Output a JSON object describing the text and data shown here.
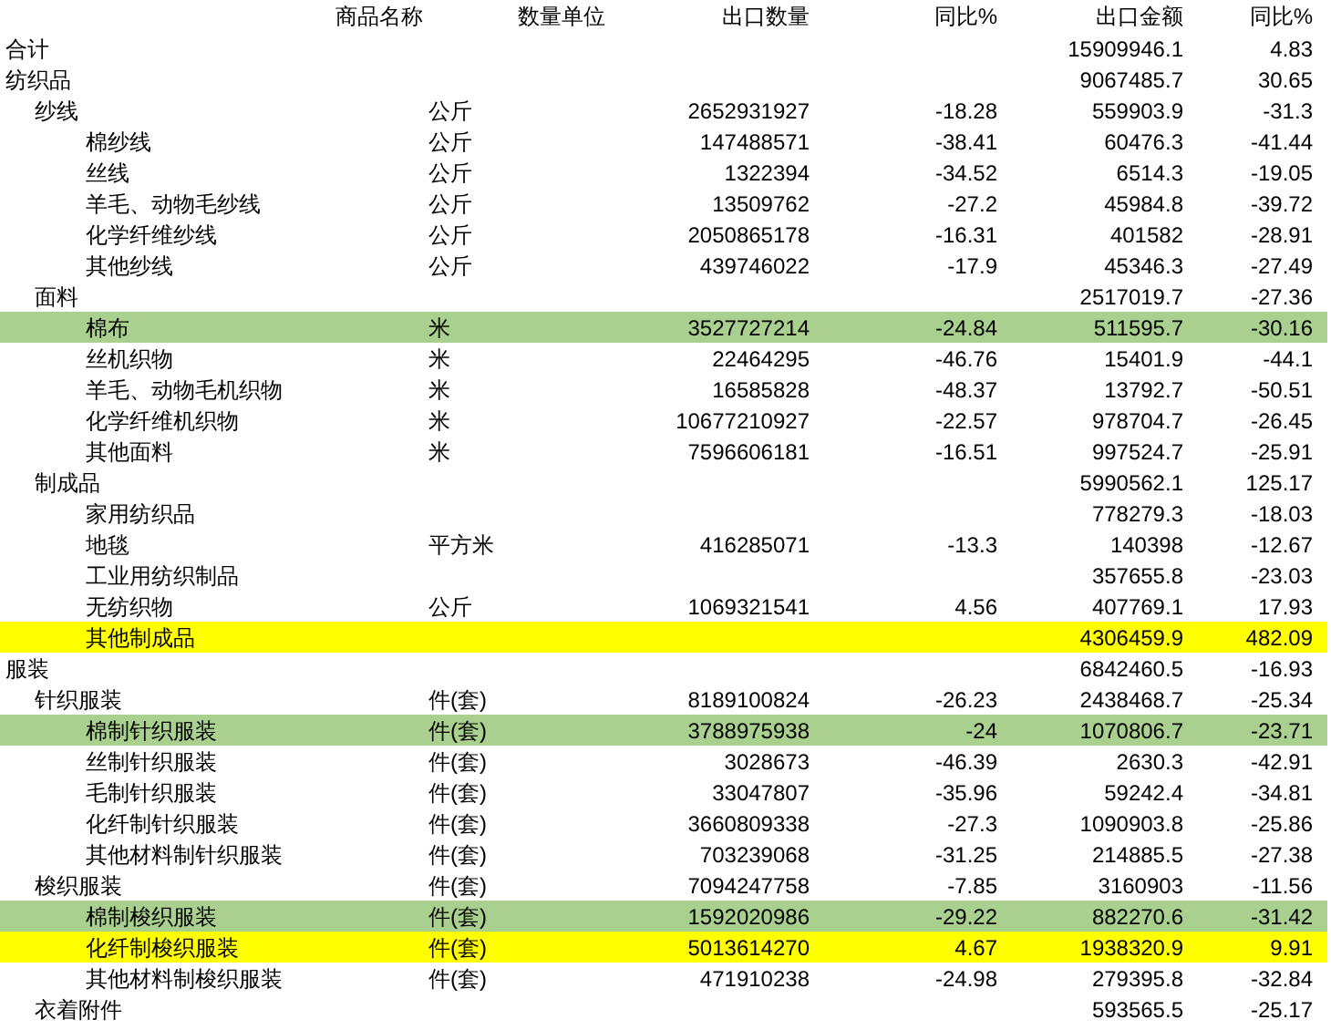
{
  "table": {
    "columns": [
      "商品名称",
      "数量单位",
      "出口数量",
      "同比%",
      "出口金额",
      "同比%"
    ],
    "rows": [
      {
        "name": "合计",
        "amount": "15909946.1",
        "amount_yoy": "4.83"
      },
      {
        "name": "纺织品",
        "amount": "9067485.7",
        "amount_yoy": "30.65",
        "children": [
          {
            "name": "纱线",
            "unit": "公斤",
            "quantity": "2652931927",
            "quantity_yoy": "-18.28",
            "amount": "559903.9",
            "amount_yoy": "-31.3",
            "children": [
              {
                "name": "棉纱线",
                "unit": "公斤",
                "quantity": "147488571",
                "quantity_yoy": "-38.41",
                "amount": "60476.3",
                "amount_yoy": "-41.44"
              },
              {
                "name": "丝线",
                "unit": "公斤",
                "quantity": "1322394",
                "quantity_yoy": "-34.52",
                "amount": "6514.3",
                "amount_yoy": "-19.05"
              },
              {
                "name": "羊毛、动物毛纱线",
                "unit": "公斤",
                "quantity": "13509762",
                "quantity_yoy": "-27.2",
                "amount": "45984.8",
                "amount_yoy": "-39.72"
              },
              {
                "name": "化学纤维纱线",
                "unit": "公斤",
                "quantity": "2050865178",
                "quantity_yoy": "-16.31",
                "amount": "401582",
                "amount_yoy": "-28.91"
              },
              {
                "name": "其他纱线",
                "unit": "公斤",
                "quantity": "439746022",
                "quantity_yoy": "-17.9",
                "amount": "45346.3",
                "amount_yoy": "-27.49"
              }
            ]
          },
          {
            "name": "面料",
            "amount": "2517019.7",
            "amount_yoy": "-27.36",
            "children": [
              {
                "name": "棉布",
                "unit": "米",
                "quantity": "3527727214",
                "quantity_yoy": "-24.84",
                "amount": "511595.7",
                "amount_yoy": "-30.16",
                "color": "#a9d08e"
              },
              {
                "name": "丝机织物",
                "unit": "米",
                "quantity": "22464295",
                "quantity_yoy": "-46.76",
                "amount": "15401.9",
                "amount_yoy": "-44.1"
              },
              {
                "name": "羊毛、动物毛机织物",
                "unit": "米",
                "quantity": "16585828",
                "quantity_yoy": "-48.37",
                "amount": "13792.7",
                "amount_yoy": "-50.51"
              },
              {
                "name": "化学纤维机织物",
                "unit": "米",
                "quantity": "10677210927",
                "quantity_yoy": "-22.57",
                "amount": "978704.7",
                "amount_yoy": "-26.45"
              },
              {
                "name": "其他面料",
                "unit": "米",
                "quantity": "7596606181",
                "quantity_yoy": "-16.51",
                "amount": "997524.7",
                "amount_yoy": "-25.91"
              }
            ]
          },
          {
            "name": "制成品",
            "amount": "5990562.1",
            "amount_yoy": "125.17",
            "children": [
              {
                "name": "家用纺织品",
                "amount": "778279.3",
                "amount_yoy": "-18.03"
              },
              {
                "name": "地毯",
                "unit": "平方米",
                "quantity": "416285071",
                "quantity_yoy": "-13.3",
                "amount": "140398",
                "amount_yoy": "-12.67"
              },
              {
                "name": "工业用纺织制品",
                "amount": "357655.8",
                "amount_yoy": "-23.03"
              },
              {
                "name": "无纺织物",
                "unit": "公斤",
                "quantity": "1069321541",
                "quantity_yoy": "4.56",
                "amount": "407769.1",
                "amount_yoy": "17.93"
              },
              {
                "name": "其他制成品",
                "amount": "4306459.9",
                "amount_yoy": "482.09",
                "color": "#ffff00"
              }
            ]
          }
        ]
      },
      {
        "name": "服装",
        "amount": "6842460.5",
        "amount_yoy": "-16.93",
        "children": [
          {
            "name": "针织服装",
            "unit": "件(套)",
            "quantity": "8189100824",
            "quantity_yoy": "-26.23",
            "amount": "2438468.7",
            "amount_yoy": "-25.34",
            "children": [
              {
                "name": "棉制针织服装",
                "unit": "件(套)",
                "quantity": "3788975938",
                "quantity_yoy": "-24",
                "amount": "1070806.7",
                "amount_yoy": "-23.71",
                "color": "#a9d08e"
              },
              {
                "name": "丝制针织服装",
                "unit": "件(套)",
                "quantity": "3028673",
                "quantity_yoy": "-46.39",
                "amount": "2630.3",
                "amount_yoy": "-42.91"
              },
              {
                "name": "毛制针织服装",
                "unit": "件(套)",
                "quantity": "33047807",
                "quantity_yoy": "-35.96",
                "amount": "59242.4",
                "amount_yoy": "-34.81"
              },
              {
                "name": "化纤制针织服装",
                "unit": "件(套)",
                "quantity": "3660809338",
                "quantity_yoy": "-27.3",
                "amount": "1090903.8",
                "amount_yoy": "-25.86"
              },
              {
                "name": "其他材料制针织服装",
                "unit": "件(套)",
                "quantity": "703239068",
                "quantity_yoy": "-31.25",
                "amount": "214885.5",
                "amount_yoy": "-27.38"
              }
            ]
          },
          {
            "name": "梭织服装",
            "unit": "件(套)",
            "quantity": "7094247758",
            "quantity_yoy": "-7.85",
            "amount": "3160903",
            "amount_yoy": "-11.56",
            "children": [
              {
                "name": "棉制梭织服装",
                "unit": "件(套)",
                "quantity": "1592020986",
                "quantity_yoy": "-29.22",
                "amount": "882270.6",
                "amount_yoy": "-31.42",
                "color": "#a9d08e"
              },
              {
                "name": "化纤制梭织服装",
                "unit": "件(套)",
                "quantity": "5013614270",
                "quantity_yoy": "4.67",
                "amount": "1938320.9",
                "amount_yoy": "9.91",
                "color": "#ffff00"
              },
              {
                "name": "其他材料制梭织服装",
                "unit": "件(套)",
                "quantity": "471910238",
                "quantity_yoy": "-24.98",
                "amount": "279395.8",
                "amount_yoy": "-32.84"
              }
            ]
          },
          {
            "name": "衣着附件",
            "amount": "593565.5",
            "amount_yoy": "-25.17"
          }
        ]
      }
    ]
  }
}
